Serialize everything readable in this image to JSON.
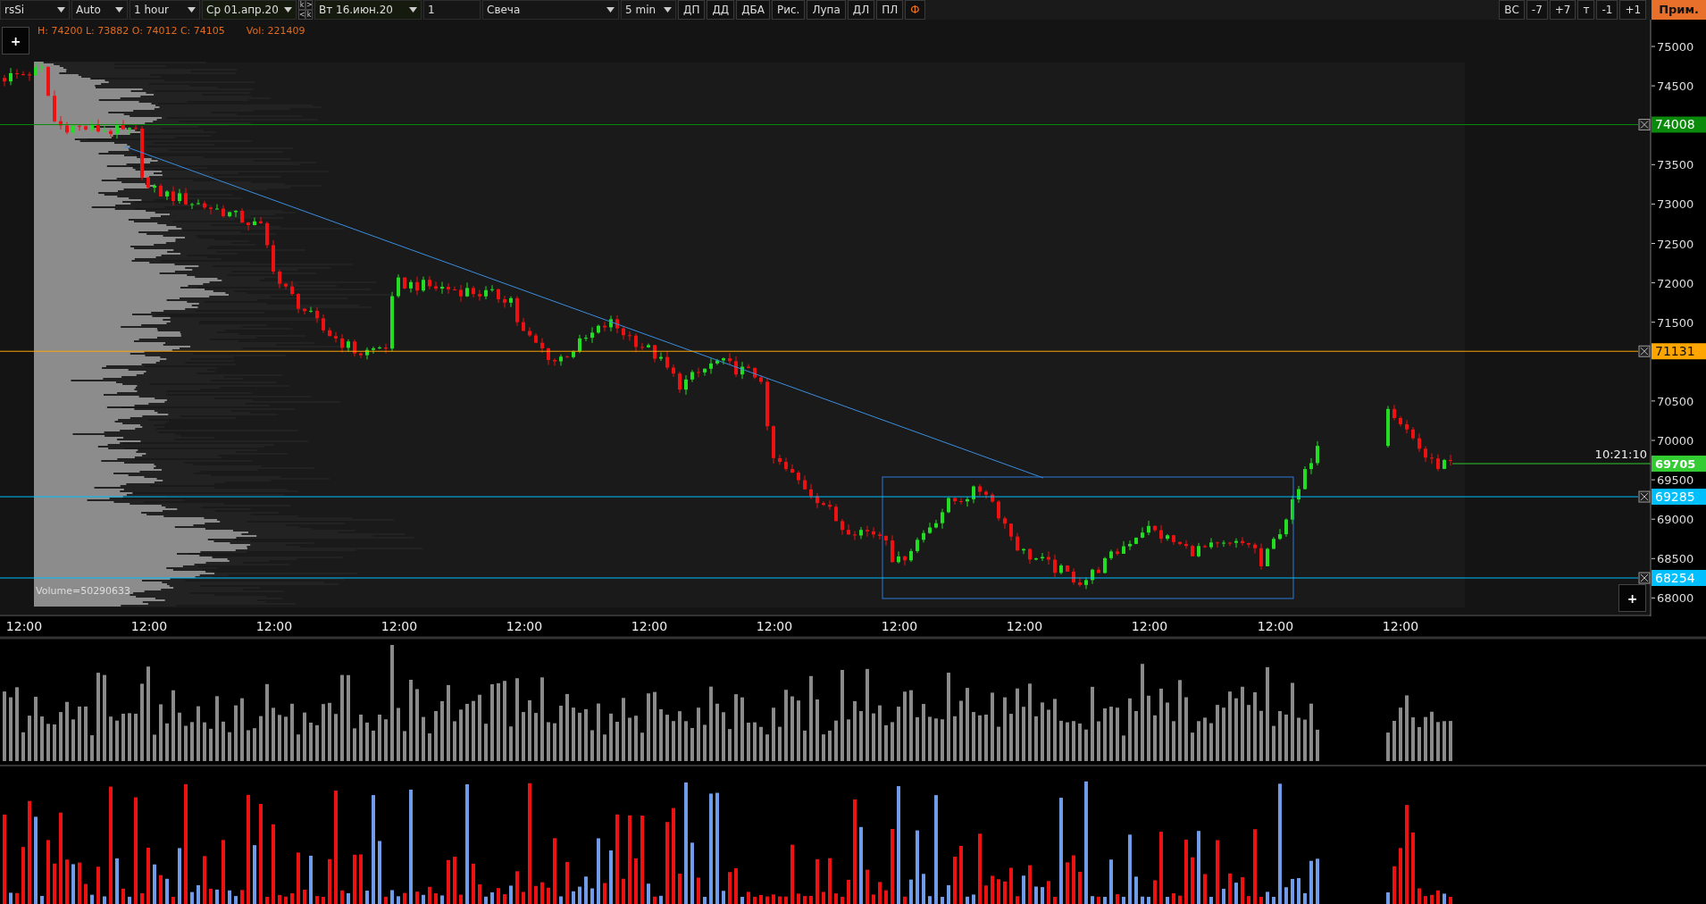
{
  "toolbar": {
    "instrument": "rsSi",
    "scale": "Auto",
    "interval": "1 hour",
    "date_from": "Ср 01.апр.20",
    "step_keys": [
      ">",
      "<"
    ],
    "step_key_labels": [
      "k",
      "k"
    ],
    "date_to": "Вт 16.июн.20",
    "count": "1",
    "chart_type": "Свеча",
    "sub_interval": "5 min",
    "tools": [
      {
        "label": "ДП",
        "highlighted": false
      },
      {
        "label": "ДД",
        "highlighted": false
      },
      {
        "label": "ДБА",
        "highlighted": false
      },
      {
        "label": "Рис.",
        "highlighted": false
      },
      {
        "label": "Лупа",
        "highlighted": false
      },
      {
        "label": "ДЛ",
        "highlighted": false
      },
      {
        "label": "ПЛ",
        "highlighted": false
      },
      {
        "label": "Ф",
        "highlighted": true
      }
    ],
    "right_buttons": [
      "ВС",
      "-7",
      "+7",
      "т",
      "-1",
      "+1"
    ],
    "apply_button": "Прим."
  },
  "chart": {
    "add_button": "+",
    "info_ohlc": "H: 74200 L: 73882 O: 74012 C: 74105",
    "info_volume": "Vol: 221409",
    "profile_label": "Volume=50290633",
    "price_ticks": [
      "75000",
      "74500",
      "73500",
      "73000",
      "72500",
      "72000",
      "71500",
      "70500",
      "70000",
      "69500",
      "69000",
      "68500",
      "68000"
    ],
    "levels": [
      {
        "price": "74008",
        "color": "#0a8a0a"
      },
      {
        "price": "71131",
        "color": "#ffa500"
      },
      {
        "price": "69285",
        "color": "#00bfff"
      },
      {
        "price": "68254",
        "color": "#00bfff"
      }
    ],
    "current": {
      "price": "69705",
      "time": "10:21:10",
      "color": "#33cc33"
    },
    "corner_button": "+",
    "time_ticks": [
      "12:00",
      "12:00",
      "12:00",
      "12:00",
      "12:00",
      "12:00",
      "12:00",
      "12:00",
      "12:00",
      "12:00",
      "12:00",
      "12:00"
    ]
  }
}
